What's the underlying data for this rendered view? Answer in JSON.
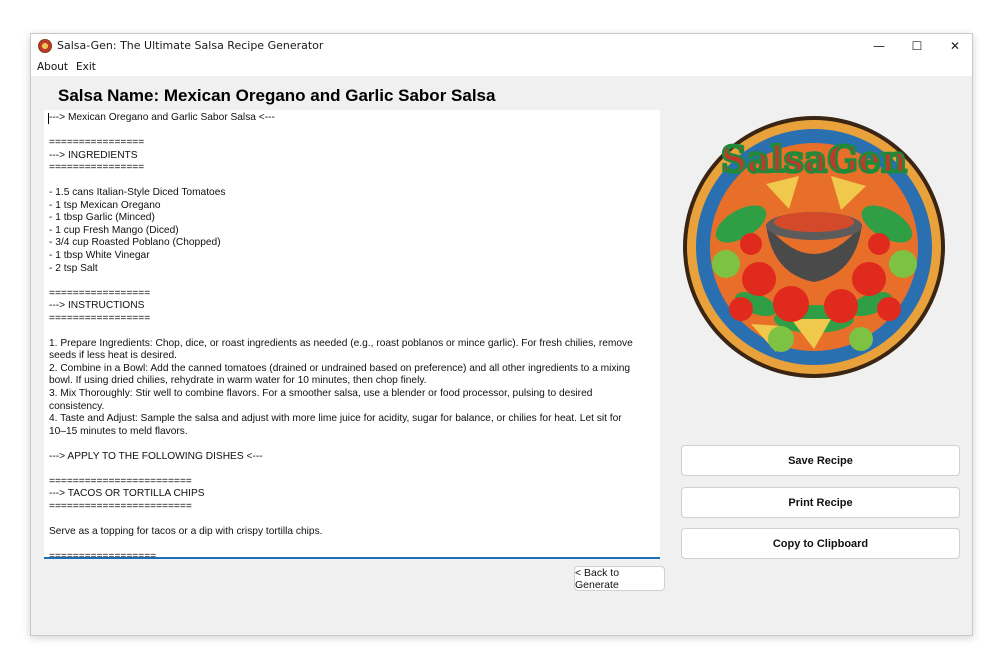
{
  "window": {
    "title": "Salsa-Gen: The Ultimate Salsa Recipe Generator",
    "controls": {
      "minimize": "—",
      "maximize": "☐",
      "close": "✕"
    }
  },
  "menu": {
    "items": [
      "About",
      "Exit"
    ]
  },
  "header": {
    "salsa_name": "Salsa Name: Mexican Oregano and Garlic Sabor Salsa"
  },
  "recipe": {
    "text": "---> Mexican Oregano and Garlic Sabor Salsa <---\n\n================\n---> INGREDIENTS\n================\n\n- 1.5 cans Italian-Style Diced Tomatoes\n- 1 tsp Mexican Oregano\n- 1 tbsp Garlic (Minced)\n- 1 cup Fresh Mango (Diced)\n- 3/4 cup Roasted Poblano (Chopped)\n- 1 tbsp White Vinegar\n- 2 tsp Salt\n\n=================\n---> INSTRUCTIONS\n=================\n\n1. Prepare Ingredients: Chop, dice, or roast ingredients as needed (e.g., roast poblanos or mince garlic). For fresh chilies, remove seeds if less heat is desired.\n2. Combine in a Bowl: Add the canned tomatoes (drained or undrained based on preference) and all other ingredients to a mixing bowl. If using dried chilies, rehydrate in warm water for 10 minutes, then chop finely.\n3. Mix Thoroughly: Stir well to combine flavors. For a smoother salsa, use a blender or food processor, pulsing to desired consistency.\n4. Taste and Adjust: Sample the salsa and adjust with more lime juice for acidity, sugar for balance, or chilies for heat. Let sit for 10–15 minutes to meld flavors.\n\n---> APPLY TO THE FOLLOWING DISHES <---\n\n========================\n---> TACOS OR TORTILLA CHIPS\n========================\n\nServe as a topping for tacos or a dip with crispy tortilla chips.\n\n==================\n---> GRILLED MEATS"
  },
  "buttons": {
    "back": "< Back to Generate",
    "save": "Save Recipe",
    "print": "Print Recipe",
    "copy": "Copy to Clipboard"
  },
  "logo": {
    "text": "SalsaGen"
  },
  "colors": {
    "accent": "#1a6fb5",
    "logo_red": "#c0392b",
    "logo_green": "#1e8a3a"
  }
}
